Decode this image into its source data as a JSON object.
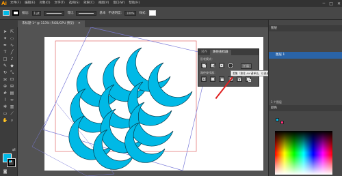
{
  "app": {
    "logo": "Ai",
    "menus": [
      "文件(F)",
      "编辑(E)",
      "对象(O)",
      "文字(T)",
      "选择(S)",
      "效果(C)",
      "视图(V)",
      "窗口(W)",
      "帮助(H)"
    ],
    "window_controls": [
      "─",
      "□",
      "✕"
    ]
  },
  "control_bar": {
    "fill_color": "#00b9e6",
    "stroke_label": "描边:",
    "stroke_value": "1 pt",
    "uniform_label": "等比",
    "basic_label": "基本",
    "opacity_label": "不透明度:",
    "opacity_value": "100%",
    "style_label": "样式:"
  },
  "document_tab": {
    "title": "未标题-1* @ 113% (RGB/GPU 预览)",
    "close": "✕"
  },
  "pathfinder_panel": {
    "tabs": [
      "对齐",
      "路径查找器"
    ],
    "active_tab": 1,
    "shape_modes_label": "形状模式：",
    "pathfinders_label": "路径查找器：",
    "expand_label": "扩展",
    "tooltip": "差集（按住 Alt 键单击，以创建一个复合形状，并保持最后的对象可编辑）"
  },
  "right_dock": {
    "layers_header": "图层",
    "layer_name": "图层 1",
    "layer_count": "1 个图层",
    "color_header": "颜色"
  },
  "colors": {
    "accent": "#00b9e6",
    "artboard_guides": "#e06666",
    "bounding_box": "#7a7ad8"
  }
}
